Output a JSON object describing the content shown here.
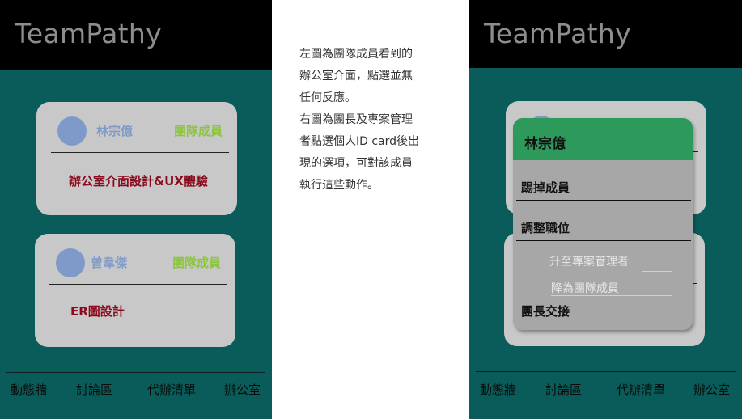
{
  "left": {
    "app_title": "TeamPathy",
    "cards": [
      {
        "name": "林宗億",
        "role": "團隊成員",
        "task": "辦公室介面設計&UX體驗"
      },
      {
        "name": "曾韋傑",
        "role": "團隊成員",
        "task": "ER圖設計"
      }
    ],
    "nav": [
      "動態牆",
      "討論區",
      "代辦清單",
      "辦公室"
    ]
  },
  "description": [
    "左圖為團隊成員看到的",
    "辦公室介面，點選並無",
    "任何反應。",
    "右圖為團長及專案管理",
    "者點選個人ID card後出",
    "現的選項，可對該成員",
    "執行這些動作。"
  ],
  "right": {
    "app_title": "TeamPathy",
    "menu": {
      "title": "林宗億",
      "items": [
        "踢掉成員",
        "調整職位",
        "團長交接"
      ],
      "sub_items": [
        "升至專案管理者",
        "降為團隊成員"
      ]
    },
    "nav": [
      "動態牆",
      "討論區",
      "代辦清單",
      "辦公室"
    ]
  },
  "colors": {
    "teal_bg": "#0a5c5a",
    "card_bg": "#c8c8c8",
    "name_blue": "#7f9ac9",
    "role_green": "#8cc63f",
    "task_red": "#8b0a1e",
    "menu_header": "#2d9a5c"
  }
}
